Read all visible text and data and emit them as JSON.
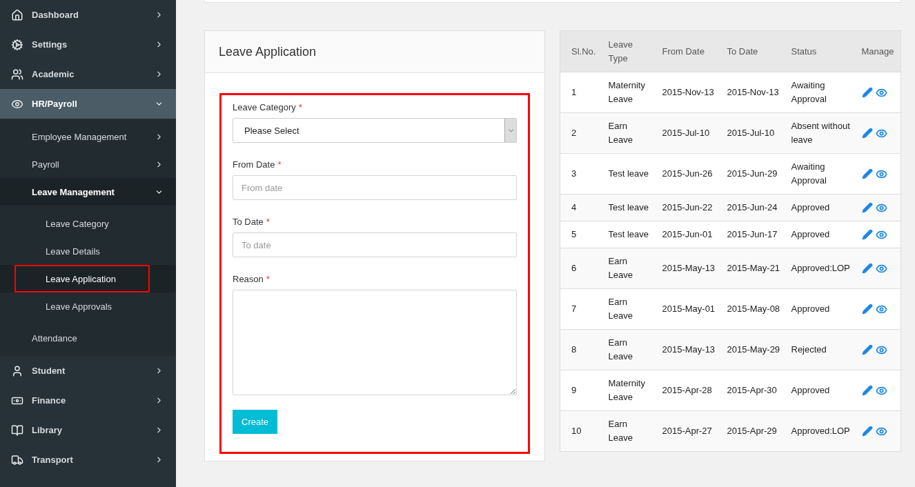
{
  "sidebar": {
    "items": [
      {
        "label": "Dashboard",
        "expanded": false,
        "selected": false
      },
      {
        "label": "Settings",
        "expanded": false,
        "selected": false
      },
      {
        "label": "Academic",
        "expanded": false,
        "selected": false
      },
      {
        "label": "HR/Payroll",
        "expanded": true,
        "selected": true,
        "children": [
          {
            "label": "Employee Management",
            "expanded": false,
            "selected": false
          },
          {
            "label": "Payroll",
            "expanded": false,
            "selected": false
          },
          {
            "label": "Leave Management",
            "expanded": true,
            "selected": true,
            "children": [
              {
                "label": "Leave Category",
                "selected": false,
                "annotated": false
              },
              {
                "label": "Leave Details",
                "selected": false,
                "annotated": false
              },
              {
                "label": "Leave Application",
                "selected": true,
                "annotated": true
              },
              {
                "label": "Leave Approvals",
                "selected": false,
                "annotated": false
              }
            ]
          },
          {
            "label": "Attendance",
            "selected": false
          }
        ]
      },
      {
        "label": "Student",
        "expanded": false,
        "selected": false
      },
      {
        "label": "Finance",
        "expanded": false,
        "selected": false
      },
      {
        "label": "Library",
        "expanded": false,
        "selected": false
      },
      {
        "label": "Transport",
        "expanded": false,
        "selected": false
      }
    ]
  },
  "form": {
    "title": "Leave Application",
    "annotated": true,
    "fields": [
      {
        "kind": "select",
        "label": "Leave Category",
        "required_mark": "*",
        "value": "Please Select"
      },
      {
        "kind": "text",
        "label": "From Date",
        "required_mark": "*",
        "placeholder": "From date"
      },
      {
        "kind": "text",
        "label": "To Date",
        "required_mark": "*",
        "placeholder": "To date"
      },
      {
        "kind": "textarea",
        "label": "Reason",
        "required_mark": "*"
      }
    ],
    "button": "Create"
  },
  "table": {
    "columns": [
      "Sl.No.",
      "Leave Type",
      "From Date",
      "To Date",
      "Status",
      "Manage"
    ],
    "rows": [
      [
        "1",
        "Maternity Leave",
        "2015-Nov-13",
        "2015-Nov-13",
        "Awaiting Approval"
      ],
      [
        "2",
        "Earn Leave",
        "2015-Jul-10",
        "2015-Jul-10",
        "Absent without leave"
      ],
      [
        "3",
        "Test leave",
        "2015-Jun-26",
        "2015-Jun-29",
        "Awaiting Approval"
      ],
      [
        "4",
        "Test leave",
        "2015-Jun-22",
        "2015-Jun-24",
        "Approved"
      ],
      [
        "5",
        "Test leave",
        "2015-Jun-01",
        "2015-Jun-17",
        "Approved"
      ],
      [
        "6",
        "Earn Leave",
        "2015-May-13",
        "2015-May-21",
        "Approved:LOP"
      ],
      [
        "7",
        "Earn Leave",
        "2015-May-01",
        "2015-May-08",
        "Approved"
      ],
      [
        "8",
        "Earn Leave",
        "2015-May-13",
        "2015-May-29",
        "Rejected"
      ],
      [
        "9",
        "Maternity Leave",
        "2015-Apr-28",
        "2015-Apr-30",
        "Approved"
      ],
      [
        "10",
        "Earn Leave",
        "2015-Apr-27",
        "2015-Apr-29",
        "Approved:LOP"
      ]
    ]
  }
}
